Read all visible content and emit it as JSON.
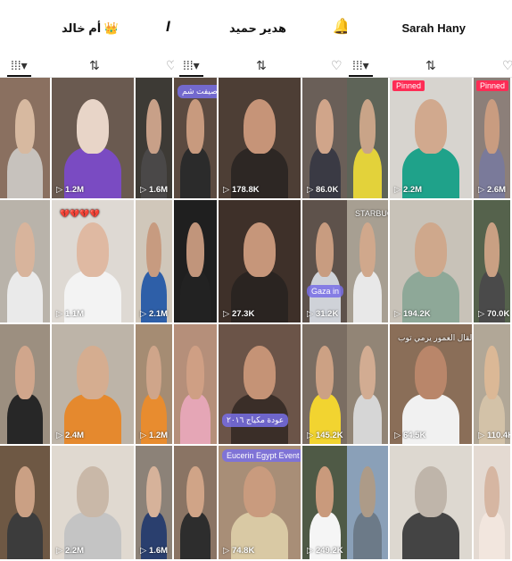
{
  "panels": [
    {
      "id": "left",
      "header_title": "أم خالد 👑",
      "header_icon_right": "bold-i-icon",
      "tabs": [
        {
          "icon": "grid-icon",
          "glyph": "⁞⁞⁞▾",
          "active": true
        },
        {
          "icon": "repost-icon",
          "glyph": "⇅",
          "active": false
        },
        {
          "icon": "liked-icon",
          "glyph": "♡",
          "active": false
        }
      ],
      "cells": [
        {
          "count": "",
          "bg": "#8a7060",
          "figure": "#d7b9a0",
          "body": "#c7c2bd"
        },
        {
          "count": "1.2M",
          "bg": "#6a5a50",
          "figure": "#e8d5c8",
          "body": "#7a4bc2"
        },
        {
          "count": "1.6M",
          "bg": "#3d3a35",
          "figure": "#c8a088",
          "body": "#4a4848"
        },
        {
          "count": "",
          "bg": "#b9b3aa",
          "figure": "#d8b49c",
          "body": "#eaeaea",
          "overlay": ""
        },
        {
          "count": "1.1M",
          "bg": "#ded9d3",
          "figure": "#dfb9a2",
          "body": "#f3f3f3",
          "overlay": "💔💔💔💔"
        },
        {
          "count": "2.1M",
          "bg": "#d0c7ba",
          "figure": "#c79b80",
          "body": "#2e5fa8"
        },
        {
          "count": "",
          "bg": "#9c8f80",
          "figure": "#d0a68c",
          "body": "#272727"
        },
        {
          "count": "2.4M",
          "bg": "#bdb4a8",
          "figure": "#d5ad90",
          "body": "#e5892e"
        },
        {
          "count": "1.2M",
          "bg": "#a58c73",
          "figure": "#cfa58a",
          "body": "#e88c2f"
        },
        {
          "count": "",
          "bg": "#6e5844",
          "figure": "#caa084",
          "body": "#3c3c3c"
        },
        {
          "count": "2.2M",
          "bg": "#e0d9d0",
          "figure": "#c9b8a8",
          "body": "#c4c4c4"
        },
        {
          "count": "1.6M",
          "bg": "#8c8278",
          "figure": "#d6b29a",
          "body": "#2a3f6e"
        }
      ]
    },
    {
      "id": "middle",
      "header_title": "هدير حميد",
      "header_icon_right": "bell-icon",
      "tabs": [
        {
          "icon": "grid-icon",
          "glyph": "⁞⁞⁞▾",
          "active": true
        },
        {
          "icon": "repost-icon",
          "glyph": "⇅",
          "active": false
        },
        {
          "icon": "liked-icon",
          "glyph": "♡",
          "active": false
        }
      ],
      "cells": [
        {
          "count": "",
          "bg": "#5b4a40",
          "figure": "#c89a7e",
          "body": "#2b2b2b",
          "overlay": "صيفت شم"
        },
        {
          "count": "178.8K",
          "bg": "#4d3e35",
          "figure": "#c69478",
          "body": "#2d2724"
        },
        {
          "count": "86.0K",
          "bg": "#6a5f58",
          "figure": "#d0a58a",
          "body": "#3a3a44"
        },
        {
          "count": "",
          "bg": "#1f1f1f",
          "figure": "#c1957b",
          "body": "#222"
        },
        {
          "count": "27.3K",
          "bg": "#3e3029",
          "figure": "#c6967a",
          "body": "#2a2421"
        },
        {
          "count": "31.2K",
          "bg": "#5e524b",
          "figure": "#c89c80",
          "body": "#cfd2d8",
          "overlay": "Gaza in"
        },
        {
          "count": "",
          "bg": "#b58f7a",
          "figure": "#cf9f84",
          "body": "#e5a6b6"
        },
        {
          "count": "",
          "bg": "#6b5448",
          "figure": "#c59376",
          "body": "#3a2e28",
          "overlay": "عودة مكياج ٢٠١٦"
        },
        {
          "count": "145.2K",
          "bg": "#7a6d62",
          "figure": "#cca184",
          "body": "#f2d430"
        },
        {
          "count": "",
          "bg": "#8a7464",
          "figure": "#d0a487",
          "body": "#2d2d2d"
        },
        {
          "count": "74.8K",
          "bg": "#a88e77",
          "figure": "#c99b7e",
          "body": "#d9c9a4",
          "overlay": "Eucerin Egypt Event"
        },
        {
          "count": "249.2K",
          "bg": "#4f5a46",
          "figure": "#c99a7c",
          "body": "#f5f5f5"
        }
      ]
    },
    {
      "id": "right",
      "header_title": "Sarah Hany",
      "header_icon_right": "",
      "tabs": [
        {
          "icon": "grid-icon",
          "glyph": "⁞⁞⁞▾",
          "active": true
        },
        {
          "icon": "repost-icon",
          "glyph": "⇅",
          "active": false
        },
        {
          "icon": "liked-icon",
          "glyph": "♡",
          "active": false
        }
      ],
      "cells": [
        {
          "count": "",
          "bg": "#5e6458",
          "figure": "#c9a488",
          "body": "#e3d23a"
        },
        {
          "count": "2.2M",
          "bg": "#d7d4cf",
          "figure": "#d1a98e",
          "body": "#1fa28a",
          "pinned": "Pinned"
        },
        {
          "count": "2.6M",
          "bg": "#8c7f79",
          "figure": "#c99c80",
          "body": "#7a7a9a",
          "pinned": "Pinned"
        },
        {
          "count": "",
          "bg": "#a79f92",
          "figure": "#d0a88c",
          "body": "#e8e8e8",
          "overlay": "STARBUCKS"
        },
        {
          "count": "194.2K",
          "bg": "#c8c2b8",
          "figure": "#cfa88c",
          "body": "#8ea898"
        },
        {
          "count": "70.0K",
          "bg": "#55624c",
          "figure": "#c9a083",
          "body": "#4a4a4a"
        },
        {
          "count": "",
          "bg": "#928576",
          "figure": "#d2ac92",
          "body": "#d6d6d6"
        },
        {
          "count": "64.5K",
          "bg": "#8a6e58",
          "figure": "#b9866a",
          "body": "#f1f1f1",
          "overlay": "القال العمور يرمي توب"
        },
        {
          "count": "110.4K",
          "bg": "#b1a797",
          "figure": "#dbb896",
          "body": "#d3c2a8"
        },
        {
          "count": "",
          "bg": "#8aa0b8",
          "figure": "#ad9b88",
          "body": "#6c7a88"
        },
        {
          "count": "",
          "bg": "#ddd8d0",
          "figure": "#bfb5aa",
          "body": "#444"
        },
        {
          "count": "",
          "bg": "#e4dad2",
          "figure": "#d6b6a2",
          "body": "#f2e6de"
        }
      ]
    }
  ]
}
